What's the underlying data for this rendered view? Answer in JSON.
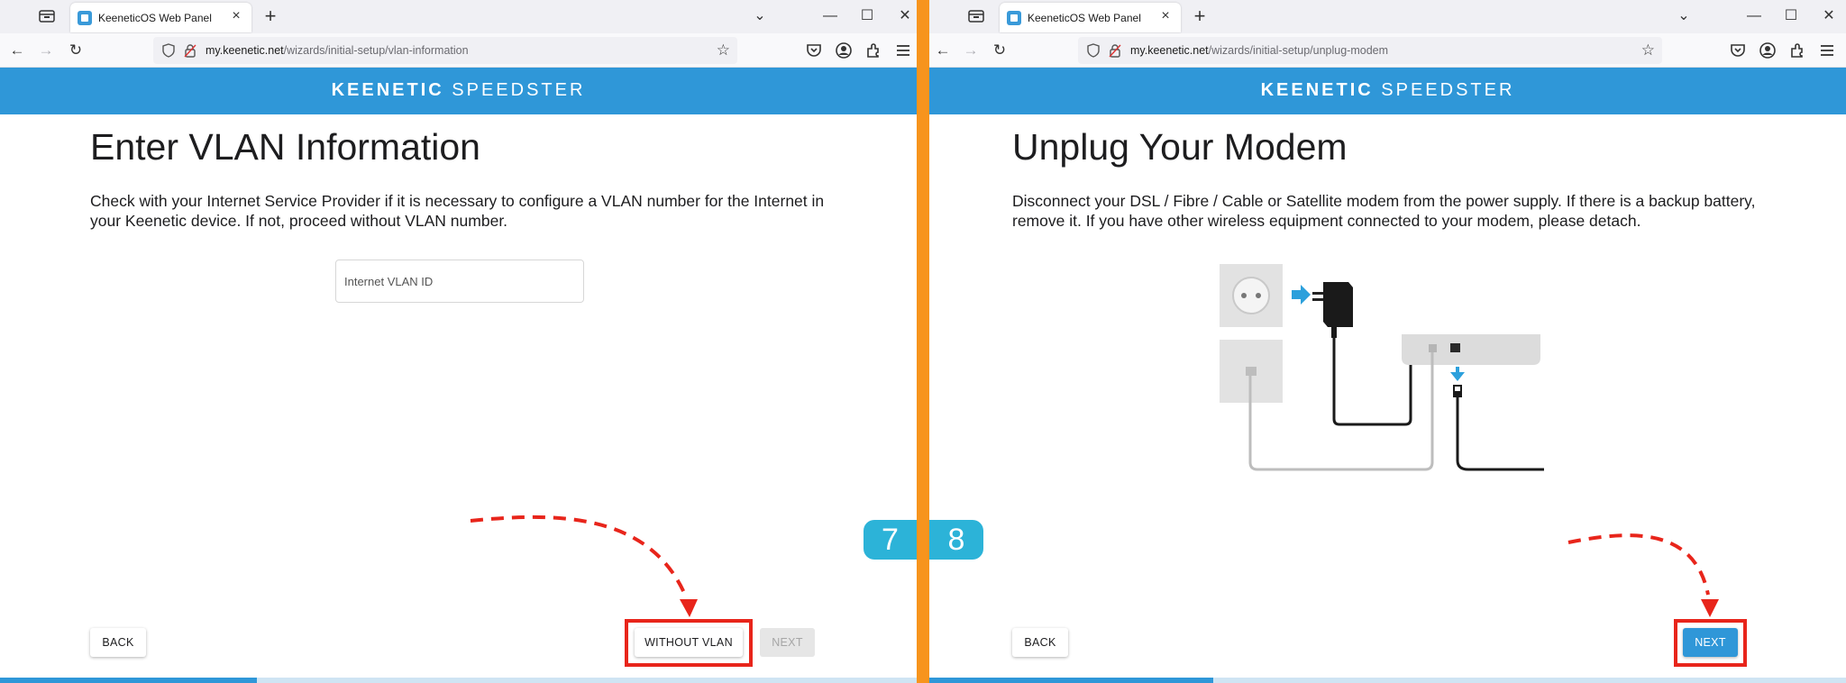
{
  "browser": {
    "tab_title": "KeeneticOS Web Panel",
    "tab_close": "×",
    "new_tab": "+",
    "win_dropdown": "⌄",
    "win_min": "—",
    "win_max": "☐",
    "win_close": "✕",
    "back": "←",
    "forward": "→",
    "reload": "↻",
    "bookmark": "☆"
  },
  "left": {
    "url_domain": "my.keenetic.net",
    "url_path": "/wizards/initial-setup/vlan-information",
    "brand_bold": "KEENETIC",
    "brand_light": "SPEEDSTER",
    "heading": "Enter VLAN Information",
    "description": "Check with your Internet Service Provider if it is necessary to configure a VLAN number for the Internet in your Keenetic device. If not, proceed without VLAN number.",
    "vlan_placeholder": "Internet VLAN ID",
    "vlan_value": "",
    "back_label": "BACK",
    "without_vlan_label": "WITHOUT VLAN",
    "next_label": "NEXT",
    "progress": 0.28,
    "step": "7"
  },
  "right": {
    "url_domain": "my.keenetic.net",
    "url_path": "/wizards/initial-setup/unplug-modem",
    "brand_bold": "KEENETIC",
    "brand_light": "SPEEDSTER",
    "heading": "Unplug Your Modem",
    "description": "Disconnect your DSL / Fibre / Cable or Satellite modem from the power supply. If there is a backup battery, remove it. If you have other wireless equipment connected to your modem, please detach.",
    "back_label": "BACK",
    "next_label": "NEXT",
    "progress": 0.31,
    "step": "8"
  },
  "colors": {
    "brand_blue": "#2f97d8",
    "divider_orange": "#f7941d",
    "highlight_red": "#e8251b",
    "step_badge": "#2cb3d8",
    "tab_bar": "#f0f0f4"
  },
  "icons": [
    "tab-list-icon",
    "favicon-icon",
    "shield-icon",
    "lock-icon",
    "star-icon",
    "pocket-icon",
    "account-icon",
    "extensions-icon",
    "menu-icon",
    "socket-icon",
    "power-adapter-icon",
    "modem-icon",
    "arrow-icon"
  ]
}
